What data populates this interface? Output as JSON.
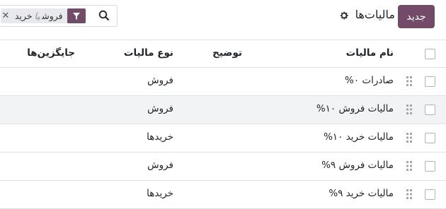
{
  "control_panel": {
    "new_button": "جدید",
    "title": "مالیات‌ها",
    "settings_icon": "gear-icon",
    "search": {
      "icon": "search-icon",
      "facet": {
        "icon": "filter-icon",
        "value1": "فروش",
        "separator": "یا",
        "value2": "خرید",
        "remove_icon": "close-icon"
      }
    }
  },
  "table": {
    "columns": {
      "name": "نام مالیات",
      "description": "توضیح",
      "type": "نوع مالیات",
      "alternatives": "جایگزین‌ها"
    },
    "rows": [
      {
        "name": "صادرات ۰%",
        "description": "",
        "type": "فروش",
        "alternatives": ""
      },
      {
        "name": "مالیات فروش ۱۰%",
        "description": "",
        "type": "فروش",
        "alternatives": ""
      },
      {
        "name": "مالیات خرید ۱۰%",
        "description": "",
        "type": "خریدها",
        "alternatives": ""
      },
      {
        "name": "مالیات فروش ۹%",
        "description": "",
        "type": "فروش",
        "alternatives": ""
      },
      {
        "name": "مالیات خرید ۹%",
        "description": "",
        "type": "خریدها",
        "alternatives": ""
      }
    ]
  },
  "colors": {
    "brand": "#714B67",
    "row_highlight": "#f2f3f4",
    "border": "#dee2e6"
  }
}
